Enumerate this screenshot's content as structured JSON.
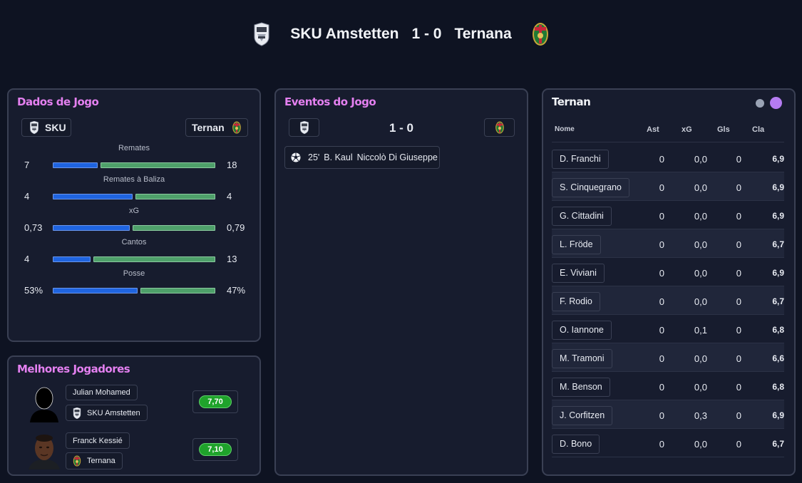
{
  "match": {
    "home_team": "SKU Amstetten",
    "score": "1 - 0",
    "away_team": "Ternana"
  },
  "game_data": {
    "title": "Dados de Jogo",
    "home_chip": "SKU",
    "away_chip": "Ternan",
    "stats": [
      {
        "label": "Remates",
        "home": "7",
        "away": "18",
        "home_share": 0.28
      },
      {
        "label": "Remates à Baliza",
        "home": "4",
        "away": "4",
        "home_share": 0.5
      },
      {
        "label": "xG",
        "home": "0,73",
        "away": "0,79",
        "home_share": 0.48
      },
      {
        "label": "Cantos",
        "home": "4",
        "away": "13",
        "home_share": 0.235
      },
      {
        "label": "Posse",
        "home": "53%",
        "away": "47%",
        "home_share": 0.53
      }
    ]
  },
  "best_players": {
    "title": "Melhores Jogadores",
    "players": [
      {
        "name": "Julian Mohamed",
        "team": "SKU Amstetten",
        "rating": "7,70"
      },
      {
        "name": "Franck Kessié",
        "team": "Ternana",
        "rating": "7,10"
      }
    ]
  },
  "events": {
    "title": "Eventos do Jogo",
    "score": "1 - 0",
    "items": [
      {
        "minute": "25'",
        "scorer": "B. Kaul",
        "assist": "Niccolò Di Giuseppe",
        "icon": "football-icon"
      }
    ]
  },
  "lineup": {
    "title": "Ternan",
    "toggle_colors": [
      "#9aa3b5",
      "#b57cf2"
    ],
    "columns": [
      "Nome",
      "Ast",
      "xG",
      "Gls",
      "Cla"
    ],
    "rows": [
      {
        "name": "D. Franchi",
        "ast": "0",
        "xg": "0,0",
        "gls": "0",
        "cla": "6,9"
      },
      {
        "name": "S. Cinquegrano",
        "ast": "0",
        "xg": "0,0",
        "gls": "0",
        "cla": "6,9"
      },
      {
        "name": "G. Cittadini",
        "ast": "0",
        "xg": "0,0",
        "gls": "0",
        "cla": "6,9"
      },
      {
        "name": "L. Fröde",
        "ast": "0",
        "xg": "0,0",
        "gls": "0",
        "cla": "6,7"
      },
      {
        "name": "E. Viviani",
        "ast": "0",
        "xg": "0,0",
        "gls": "0",
        "cla": "6,9"
      },
      {
        "name": "F. Rodio",
        "ast": "0",
        "xg": "0,0",
        "gls": "0",
        "cla": "6,7"
      },
      {
        "name": "O. Iannone",
        "ast": "0",
        "xg": "0,1",
        "gls": "0",
        "cla": "6,8"
      },
      {
        "name": "M. Tramoni",
        "ast": "0",
        "xg": "0,0",
        "gls": "0",
        "cla": "6,6"
      },
      {
        "name": "M. Benson",
        "ast": "0",
        "xg": "0,0",
        "gls": "0",
        "cla": "6,8"
      },
      {
        "name": "J. Corfitzen",
        "ast": "0",
        "xg": "0,3",
        "gls": "0",
        "cla": "6,9"
      },
      {
        "name": "D. Bono",
        "ast": "0",
        "xg": "0,0",
        "gls": "0",
        "cla": "6,7"
      }
    ]
  },
  "colors": {
    "accent_pink": "#e480f0",
    "home_bar": "#1f64e0",
    "away_bar": "#4ea06a",
    "rating_green": "#1fa32b"
  }
}
